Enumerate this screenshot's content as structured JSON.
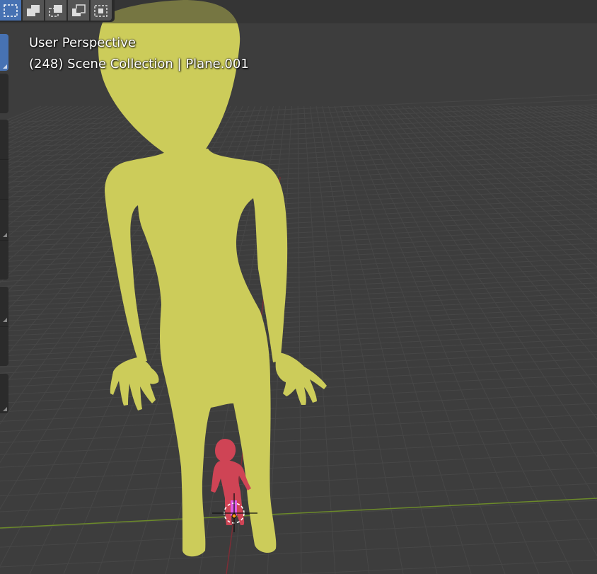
{
  "viewport": {
    "perspective_label": "User Perspective",
    "collection_frame": "(248)",
    "collection_name": "Scene Collection",
    "separator": "|",
    "active_object": "Plane.001"
  },
  "selection_modes": [
    {
      "name": "new",
      "active": true
    },
    {
      "name": "extend",
      "active": false
    },
    {
      "name": "subtract",
      "active": false
    },
    {
      "name": "invert",
      "active": false
    },
    {
      "name": "intersect",
      "active": false
    }
  ],
  "colors": {
    "background": "#3d3d3d",
    "grid": "#474747",
    "x_axis": "#7e2d36",
    "y_axis": "#6c8a2a",
    "large_figure": "#cccc5a",
    "small_figure": "#cf4455",
    "selected_accent": "#e05ce6",
    "active_button": "#4772b3"
  }
}
